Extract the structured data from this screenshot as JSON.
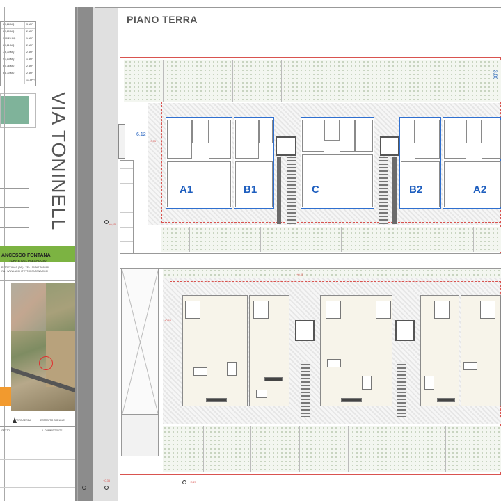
{
  "drawing": {
    "floor_title": "PIANO TERRA",
    "street_name": "VIA TONINELL",
    "units_top": [
      "A1",
      "B1",
      "C",
      "B2",
      "A2"
    ]
  },
  "title_block": {
    "architect_line": "ANCESCO FONTANA",
    "architect_sub": "TTURA E DEL PAESAGGIO",
    "contact_line": "DI TREVIGLIO (BG) · TEL +39 347 0000000",
    "web_line": "ITA · WWW.ARCHITETTOFONTANA.COM",
    "label_left": "FOTO AEREA",
    "label_right": "ESTRATTO SIGNOLE",
    "bottom_left": "GETTO",
    "bottom_right": "IL COMMITTENTE"
  },
  "area_table": {
    "rows": [
      {
        "area": "60,26 MQ",
        "units": "3 APP."
      },
      {
        "area": "67,80 MQ",
        "units": "2 APP."
      },
      {
        "area": "100,25 MQ",
        "units": "1 APP."
      },
      {
        "area": "60,81 MQ",
        "units": "2 APP."
      },
      {
        "area": "76,30 MQ",
        "units": "2 APP."
      },
      {
        "area": "91,13 MQ",
        "units": "1 APP."
      },
      {
        "area": "60,36 MQ",
        "units": "2 APP."
      },
      {
        "area": "68,70 MQ",
        "units": "2 APP."
      },
      {
        "area": "",
        "units": "13 APP."
      }
    ]
  },
  "dimensions": {
    "d1": "6,12",
    "d2": "+0,35",
    "d3": "+0,65",
    "d4": "+0,35",
    "d5": "+0,65",
    "d6": "+0,35",
    "d7": "+0,25",
    "d8": "3,00"
  },
  "colors": {
    "accent_green": "#7cb342",
    "accent_orange": "#f29a2e",
    "unit_blue": "#1f5fbf",
    "boundary_red": "#d9534f"
  }
}
